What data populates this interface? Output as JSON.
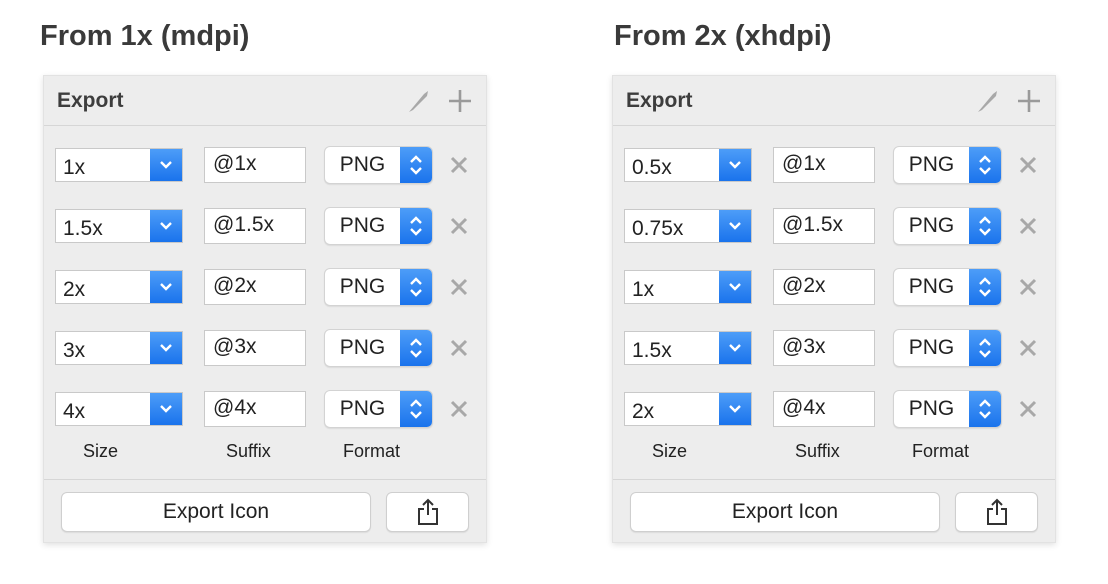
{
  "panels": [
    {
      "heading": "From 1x (mdpi)",
      "title": "Export",
      "rows": [
        {
          "size": "1x",
          "suffix": "@1x",
          "format": "PNG"
        },
        {
          "size": "1.5x",
          "suffix": "@1.5x",
          "format": "PNG"
        },
        {
          "size": "2x",
          "suffix": "@2x",
          "format": "PNG"
        },
        {
          "size": "3x",
          "suffix": "@3x",
          "format": "PNG"
        },
        {
          "size": "4x",
          "suffix": "@4x",
          "format": "PNG"
        }
      ],
      "labels": {
        "size": "Size",
        "suffix": "Suffix",
        "format": "Format"
      },
      "export_label": "Export Icon"
    },
    {
      "heading": "From 2x (xhdpi)",
      "title": "Export",
      "rows": [
        {
          "size": "0.5x",
          "suffix": "@1x",
          "format": "PNG"
        },
        {
          "size": "0.75x",
          "suffix": "@1.5x",
          "format": "PNG"
        },
        {
          "size": "1x",
          "suffix": "@2x",
          "format": "PNG"
        },
        {
          "size": "1.5x",
          "suffix": "@3x",
          "format": "PNG"
        },
        {
          "size": "2x",
          "suffix": "@4x",
          "format": "PNG"
        }
      ],
      "labels": {
        "size": "Size",
        "suffix": "Suffix",
        "format": "Format"
      },
      "export_label": "Export Icon"
    }
  ],
  "icons": {
    "edit": "slice-knife-icon",
    "add": "plus-icon",
    "size_dropdown": "chevron-down-icon",
    "format_dropdown": "up-down-chevron-icon",
    "remove": "close-icon",
    "share": "share-icon"
  },
  "colors": {
    "accent": "#2f86f4",
    "panel_bg": "#ededed",
    "icon_gray": "#a8a8a8"
  }
}
